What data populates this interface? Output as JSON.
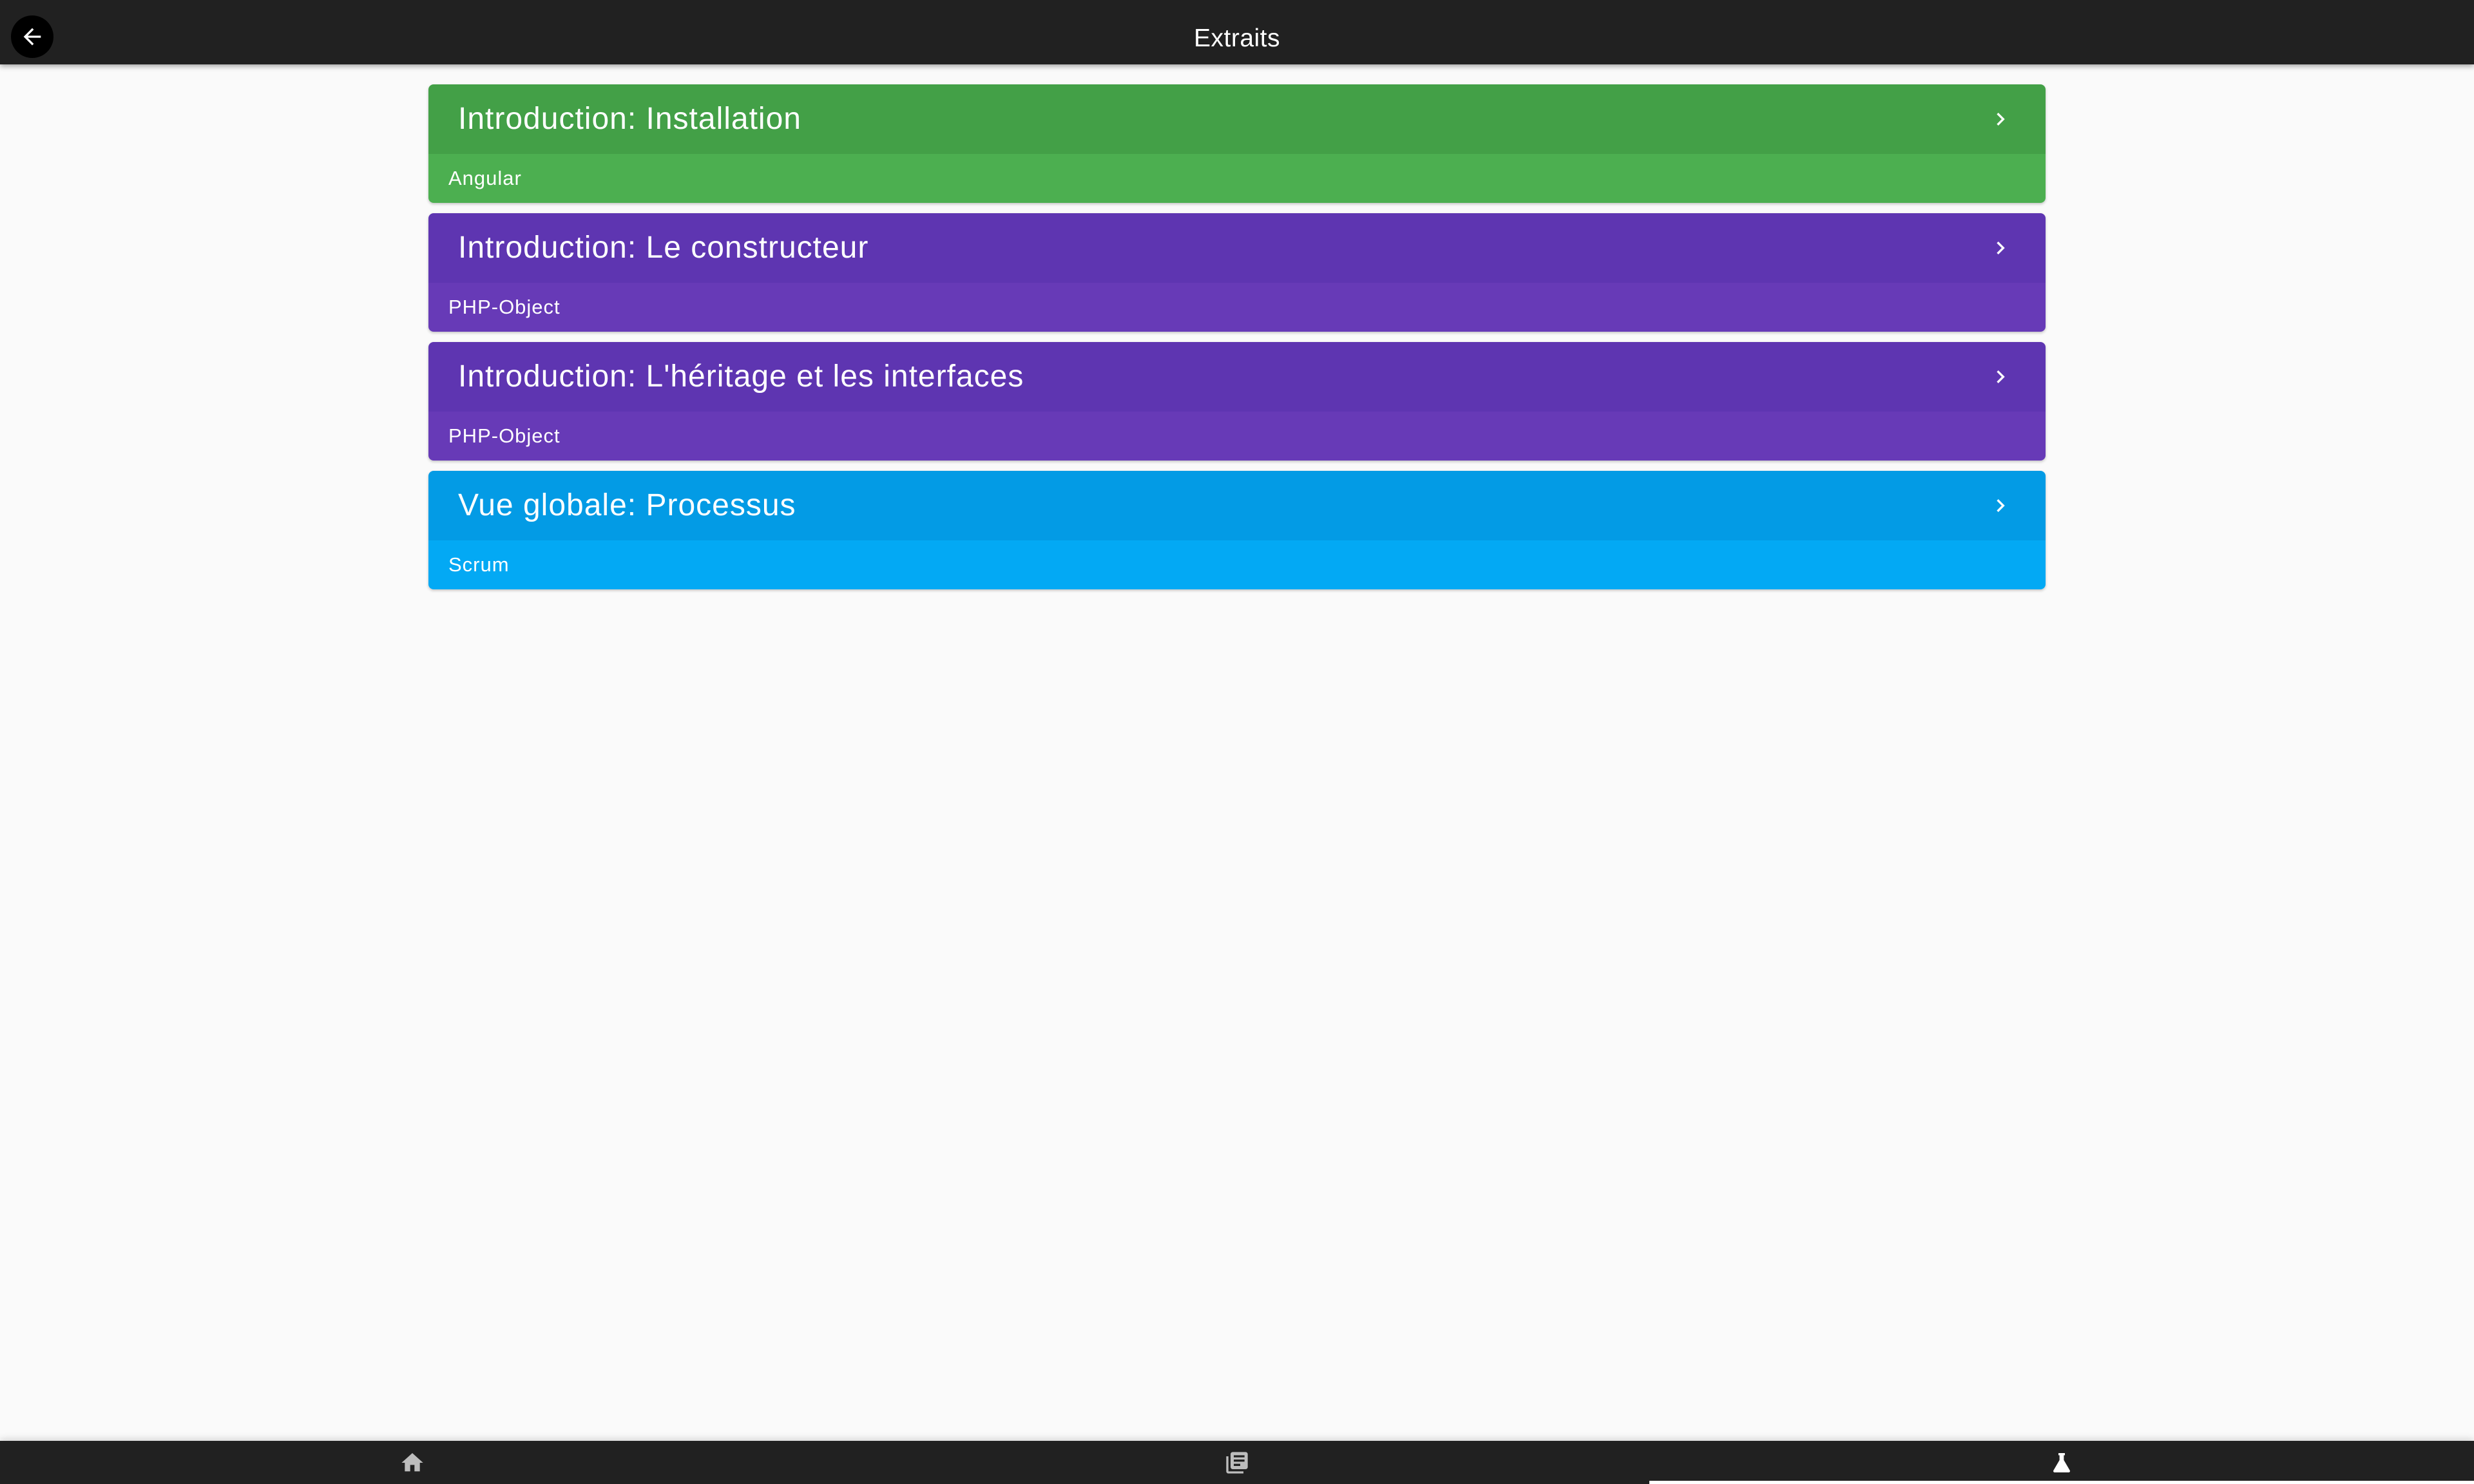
{
  "app_bar": {
    "title": "Extraits",
    "back_icon": "arrow-back-icon"
  },
  "cards": [
    {
      "title": "Introduction: Installation",
      "subtitle": "Angular",
      "header_color": "#43a047",
      "footer_color": "#4caf50",
      "chevron_icon": "chevron-right-icon"
    },
    {
      "title": "Introduction: Le constructeur",
      "subtitle": "PHP-Object",
      "header_color": "#5e35b1",
      "footer_color": "#673ab7",
      "chevron_icon": "chevron-right-icon"
    },
    {
      "title": "Introduction: L'héritage et les interfaces",
      "subtitle": "PHP-Object",
      "header_color": "#5e35b1",
      "footer_color": "#673ab7",
      "chevron_icon": "chevron-right-icon"
    },
    {
      "title": "Vue globale: Processus",
      "subtitle": "Scrum",
      "header_color": "#039be5",
      "footer_color": "#03a9f4",
      "chevron_icon": "chevron-right-icon"
    }
  ],
  "bottom_nav": {
    "items": [
      {
        "icon": "home-icon",
        "active": false
      },
      {
        "icon": "library-books-icon",
        "active": false
      },
      {
        "icon": "flask-icon",
        "active": true
      }
    ],
    "icon_color": "#bdbdbd",
    "active_color": "#ffffff"
  },
  "colors": {
    "app_bar": "#212121",
    "background": "#fafafa"
  }
}
